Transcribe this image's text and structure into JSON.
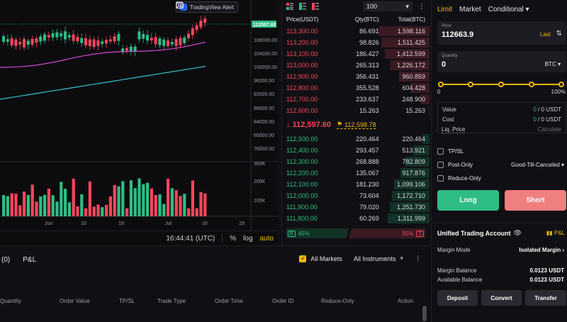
{
  "chart": {
    "tradingview_alert": "TradingView Alert",
    "price_ticks": [
      "108000.00",
      "104000.00",
      "100000.00",
      "96000.00",
      "92000.00",
      "88000.00",
      "84000.00",
      "80000.00",
      "76000.00"
    ],
    "current_price_tag": "112597.60",
    "volume_ticks": [
      "300K",
      "200K",
      "100K"
    ],
    "date_ticks": [
      "Jun",
      "10",
      "19",
      "Jul",
      "10",
      "19"
    ],
    "time": "16:44:41 (UTC)",
    "percent_label": "%",
    "log_label": "log",
    "auto_label": "auto",
    "colors": {
      "up": "#2ebd85",
      "down": "#f6465d",
      "ma_fast": "#d04bd0",
      "ma_slow": "#37c2c2"
    }
  },
  "orderbook": {
    "depth": "100",
    "headers": {
      "price": "Price(USDT)",
      "qty": "Qty(BTC)",
      "total": "Total(BTC)"
    },
    "asks": [
      {
        "price": "113,300.00",
        "qty": "86.691",
        "total": "1,598.116",
        "depth": 1.0
      },
      {
        "price": "113,200.00",
        "qty": "98.826",
        "total": "1,511.425",
        "depth": 0.95
      },
      {
        "price": "113,100.00",
        "qty": "186.427",
        "total": "1,412.599",
        "depth": 0.88
      },
      {
        "price": "113,000.00",
        "qty": "265.313",
        "total": "1,226.172",
        "depth": 0.77
      },
      {
        "price": "112,900.00",
        "qty": "356.431",
        "total": "960.859",
        "depth": 0.6
      },
      {
        "price": "112,800.00",
        "qty": "355.528",
        "total": "604.428",
        "depth": 0.38
      },
      {
        "price": "112,700.00",
        "qty": "233.637",
        "total": "248.900",
        "depth": 0.16
      },
      {
        "price": "112,600.00",
        "qty": "15.263",
        "total": "15.263",
        "depth": 0.02
      }
    ],
    "last_price": "112,597.60",
    "mark_price": "112,598.78",
    "bids": [
      {
        "price": "112,500.00",
        "qty": "220.464",
        "total": "220.464",
        "depth": 0.14
      },
      {
        "price": "112,400.00",
        "qty": "293.457",
        "total": "513.921",
        "depth": 0.32
      },
      {
        "price": "112,300.00",
        "qty": "268.888",
        "total": "782.809",
        "depth": 0.49
      },
      {
        "price": "112,200.00",
        "qty": "135.067",
        "total": "917.876",
        "depth": 0.57
      },
      {
        "price": "112,100.00",
        "qty": "181.230",
        "total": "1,099.106",
        "depth": 0.69
      },
      {
        "price": "112,000.00",
        "qty": "73.604",
        "total": "1,172.710",
        "depth": 0.73
      },
      {
        "price": "111,900.00",
        "qty": "79.020",
        "total": "1,251.730",
        "depth": 0.78
      },
      {
        "price": "111,800.00",
        "qty": "60.269",
        "total": "1,311.999",
        "depth": 0.82
      }
    ],
    "buy_tag": "B",
    "buy_pct": "45%",
    "sell_pct": "55%",
    "sell_tag": "S"
  },
  "orders": {
    "tab_count": "(0)",
    "tab_pnl": "P&L",
    "all_markets": "All Markets",
    "all_instruments": "All Instruments",
    "columns": [
      "Quantity",
      "Order Value",
      "TP/SL",
      "Trade Type",
      "Order Time",
      "Order ID",
      "Reduce-Only",
      "Action"
    ]
  },
  "trade": {
    "tabs": {
      "limit": "Limit",
      "market": "Market",
      "conditional": "Conditional"
    },
    "price": {
      "label": "Price",
      "value": "112663.9",
      "last": "Last"
    },
    "quantity": {
      "label": "Quantity",
      "value": "0",
      "unit": "BTC"
    },
    "slider": {
      "min": "0",
      "max": "100%",
      "value_pct": 100
    },
    "value_label": "Value",
    "value_left": "0",
    "value_right": "0 USDT",
    "cost_label": "Cost",
    "cost_left": "0",
    "cost_right": "0 USDT",
    "liq_label": "Liq. Price",
    "liq_value": "Calculate",
    "tpsl": "TP/SL",
    "post_only": "Post-Only",
    "tif": "Good-Till-Canceled",
    "reduce_only": "Reduce-Only",
    "long": "Long",
    "short": "Short",
    "uta_title": "Unified Trading Account",
    "pnl": "P&L",
    "margin_mode_label": "Margin Mode",
    "margin_mode_value": "Isolated Margin",
    "margin_balance_label": "Margin Balance",
    "margin_balance_value": "0.0123 USDT",
    "available_balance_label": "Available Balance",
    "available_balance_value": "0.0123 USDT",
    "deposit": "Deposit",
    "convert": "Convert",
    "transfer": "Transfer"
  }
}
